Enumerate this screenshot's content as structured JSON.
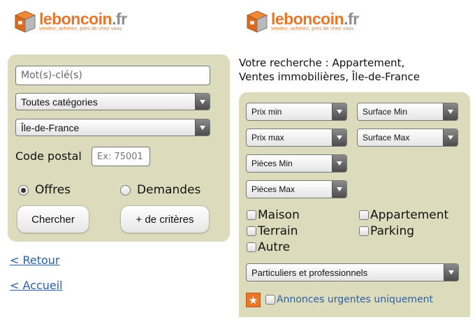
{
  "left": {
    "logo": {
      "name": "leboncoin",
      "tld": ".fr",
      "tagline": "vendez, achetez, près de chez vous"
    },
    "keywords_placeholder": "Mot(s)-clé(s)",
    "category_select": "Toutes catégories",
    "region_select": "Île-de-France",
    "postal_label": "Code postal",
    "postal_placeholder": "Ex: 75001",
    "radio_offers": "Offres",
    "radio_requests": "Demandes",
    "search_button": "Chercher",
    "more_criteria_button": "+ de critères",
    "back_link": "< Retour",
    "home_link": "< Accueil"
  },
  "right": {
    "logo": {
      "name": "leboncoin",
      "tld": ".fr",
      "tagline": "vendez, achetez, près de chez vous"
    },
    "search_title_line1": "Votre recherche : Appartement,",
    "search_title_line2": "Ventes immobilières, Île-de-France",
    "selects": {
      "prix_min": "Prix min",
      "surface_min": "Surface Min",
      "prix_max": "Prix max",
      "surface_max": "Surface Max",
      "pieces_min": "Pièces Min",
      "pieces_max": "Pièces Max"
    },
    "checkboxes": {
      "maison": "Maison",
      "appartement": "Appartement",
      "terrain": "Terrain",
      "parking": "Parking",
      "autre": "Autre"
    },
    "seller_select": "Particuliers et professionnels",
    "urgent_label": "Annonces urgentes uniquement"
  },
  "colors": {
    "panel": "#dcdcbc",
    "brand_orange": "#e8772a",
    "link": "#2c5fa6"
  }
}
